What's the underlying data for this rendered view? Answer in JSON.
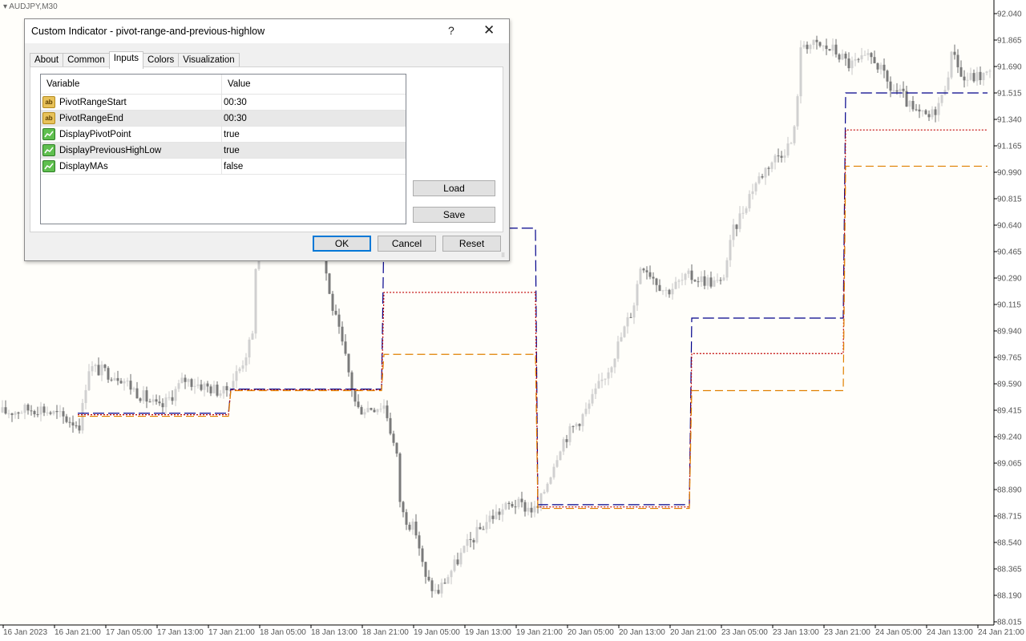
{
  "chart": {
    "symbol": "AUDJPY,M30",
    "y_ticks": [
      "92.040",
      "91.865",
      "91.690",
      "91.515",
      "91.340",
      "91.165",
      "90.990",
      "90.815",
      "90.640",
      "90.465",
      "90.290",
      "90.115",
      "89.940",
      "89.765",
      "89.590",
      "89.415",
      "89.240",
      "89.065",
      "88.890",
      "88.715",
      "88.540",
      "88.365",
      "88.190",
      "88.015"
    ],
    "x_ticks": [
      "16 Jan 2023",
      "16 Jan 21:00",
      "17 Jan 05:00",
      "17 Jan 13:00",
      "17 Jan 21:00",
      "18 Jan 05:00",
      "18 Jan 13:00",
      "18 Jan 21:00",
      "19 Jan 05:00",
      "19 Jan 13:00",
      "19 Jan 21:00",
      "20 Jan 05:00",
      "20 Jan 13:00",
      "20 Jan 21:00",
      "23 Jan 05:00",
      "23 Jan 13:00",
      "23 Jan 21:00",
      "24 Jan 05:00",
      "24 Jan 13:00",
      "24 Jan 21:00"
    ],
    "colors": {
      "pivot_line": "#00008b",
      "prev_high": "#c00000",
      "prev_low": "#e08000",
      "candles": "#9a9a9a"
    }
  },
  "dialog": {
    "title": "Custom Indicator - pivot-range-and-previous-highlow",
    "help_glyph": "?",
    "close_glyph": "✕",
    "tabs": [
      {
        "label": "About"
      },
      {
        "label": "Common"
      },
      {
        "label": "Inputs",
        "active": true
      },
      {
        "label": "Colors"
      },
      {
        "label": "Visualization"
      }
    ],
    "table": {
      "col_variable": "Variable",
      "col_value": "Value",
      "rows": [
        {
          "icon": "string-param-icon",
          "badge": "ab",
          "variable": "PivotRangeStart",
          "value": "00:30"
        },
        {
          "icon": "string-param-icon",
          "badge": "ab",
          "variable": "PivotRangeEnd",
          "value": "00:30"
        },
        {
          "icon": "bool-param-icon",
          "badge": "",
          "variable": "DisplayPivotPoint",
          "value": "true"
        },
        {
          "icon": "bool-param-icon",
          "badge": "",
          "variable": "DisplayPreviousHighLow",
          "value": "true"
        },
        {
          "icon": "bool-param-icon",
          "badge": "",
          "variable": "DisplayMAs",
          "value": "false"
        }
      ]
    },
    "buttons": {
      "load": "Load",
      "save": "Save",
      "ok": "OK",
      "cancel": "Cancel",
      "reset": "Reset"
    }
  }
}
